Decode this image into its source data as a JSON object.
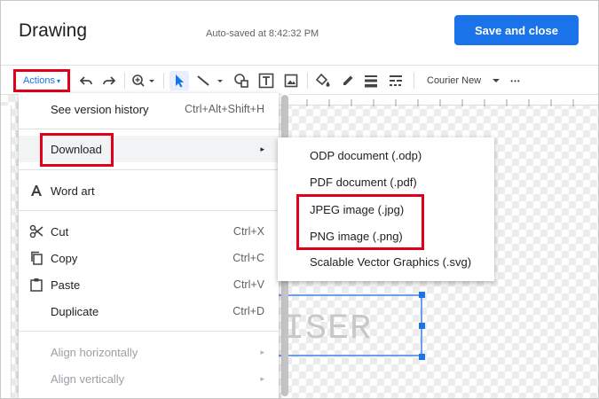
{
  "header": {
    "title": "Drawing",
    "autosave": "Auto-saved at 8:42:32 PM",
    "save_label": "Save and close"
  },
  "toolbar": {
    "actions_label": "Actions",
    "font": "Courier New",
    "more": "•••",
    "icons": [
      "undo-icon",
      "redo-icon",
      "zoom-icon",
      "select-icon",
      "line-icon",
      "shape-icon",
      "textbox-icon",
      "image-icon",
      "fill-color-icon",
      "border-color-icon",
      "border-weight-icon",
      "border-dash-icon"
    ]
  },
  "actions_menu": {
    "items": [
      {
        "label": "See version history",
        "shortcut": "Ctrl+Alt+Shift+H"
      },
      {
        "label": "Download",
        "submenu_arrow": "▸"
      },
      {
        "label": "Word art"
      },
      {
        "label": "Cut",
        "shortcut": "Ctrl+X"
      },
      {
        "label": "Copy",
        "shortcut": "Ctrl+C"
      },
      {
        "label": "Paste",
        "shortcut": "Ctrl+V"
      },
      {
        "label": "Duplicate",
        "shortcut": "Ctrl+D"
      },
      {
        "label": "Align horizontally",
        "submenu_arrow": "▸"
      },
      {
        "label": "Align vertically",
        "submenu_arrow": "▸"
      }
    ]
  },
  "download_submenu": {
    "items": [
      "ODP document (.odp)",
      "PDF document (.pdf)",
      "JPEG image (.jpg)",
      "PNG image (.png)",
      "Scalable Vector Graphics (.svg)"
    ]
  },
  "canvas": {
    "textbox_text": "ISER"
  },
  "colors": {
    "accent": "#1a73e8",
    "highlight": "#e0001b"
  }
}
